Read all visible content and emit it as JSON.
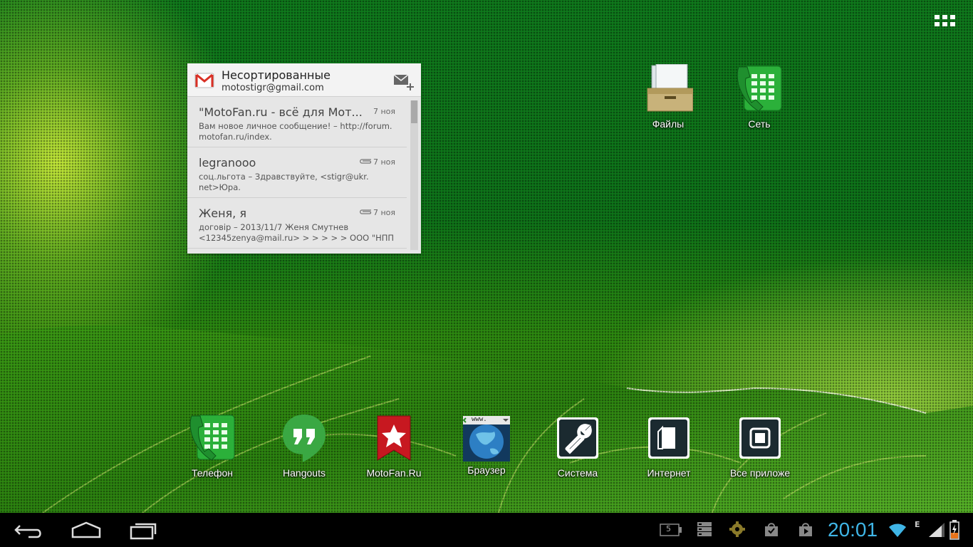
{
  "gmail_widget": {
    "folder": "Несортированные",
    "account": "motostigr@gmail.com",
    "messages": [
      {
        "sender": "\"MotoFan.ru - всё для Мот...",
        "date": "7 ноя",
        "snippet_line1": "Вам новое личное сообщение! – http://forum.",
        "snippet_line2": "motofan.ru/index."
      },
      {
        "sender": "legranooo",
        "date": "7 ноя",
        "snippet_line1": "соц.льгота – Здравствуйте, <stigr@ukr.",
        "snippet_line2": "net>Юра."
      },
      {
        "sender": "Женя, я",
        "date": "7 ноя",
        "snippet_line1": "договір – 2013/11/7 Женя Смутнев",
        "snippet_line2": "<12345zenya@mail.ru> > > > > > ООО \"НПП"
      }
    ]
  },
  "desktop_shortcuts": {
    "files": "Файлы",
    "network": "Сеть"
  },
  "dock": {
    "phone": "Телефон",
    "hangouts": "Hangouts",
    "motofan": "MotoFan.Ru",
    "browser": "Браузер",
    "system": "Система",
    "internet": "Интернет",
    "all_apps": "Все приложе"
  },
  "browser_icon_text": "www.",
  "status_bar": {
    "time": "20:01",
    "notification_count": "5",
    "network_type": "E"
  },
  "icons": [
    "apps-grid-icon",
    "gmail-icon",
    "compose-mail-icon",
    "attachment-icon",
    "file-cabinet-icon",
    "phone-dialer-icon",
    "hangouts-icon",
    "bookmark-star-icon",
    "globe-icon",
    "wrench-icon",
    "back-icon",
    "home-icon",
    "recent-apps-icon",
    "wifi-icon",
    "signal-icon",
    "battery-icon"
  ],
  "colors": {
    "clock": "#3fb5e6",
    "wallpaper_green": "#0f7a1c",
    "navbar": "#000000"
  }
}
